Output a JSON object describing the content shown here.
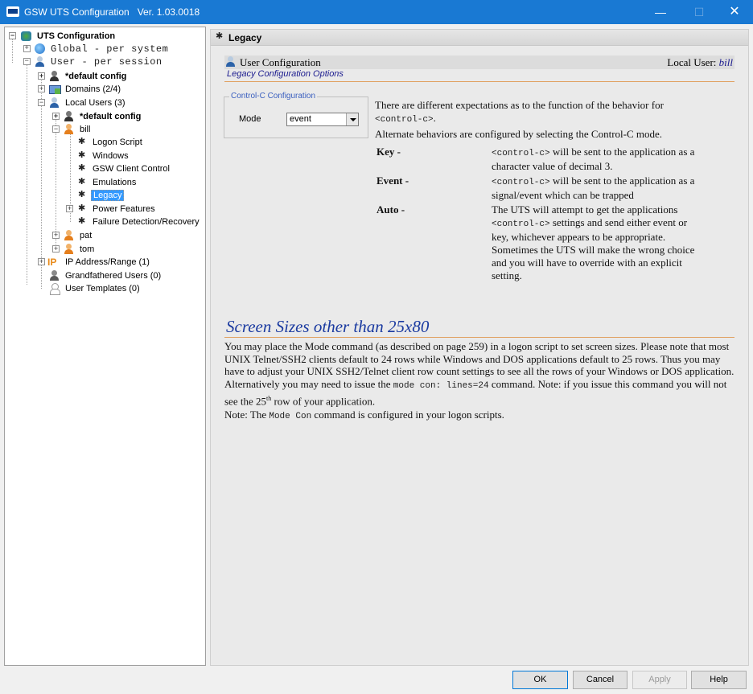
{
  "window": {
    "title": "GSW UTS Configuration",
    "version": "Ver. 1.03.0018",
    "min_glyph": "—",
    "max_glyph": "☐",
    "close_glyph": "✕"
  },
  "tree": {
    "root": "UTS Configuration",
    "global": "Global - per system",
    "user": "User  - per session",
    "default_config": "*default config",
    "domains": "Domains (2/4)",
    "local_users": "Local Users (3)",
    "local_default": "*default config",
    "bill": "bill",
    "bill_children": [
      "Logon Script",
      "Windows",
      "GSW Client Control",
      "Emulations",
      "Legacy",
      "Power Features",
      "Failure Detection/Recovery"
    ],
    "pat": "pat",
    "tom": "tom",
    "ip_range": "IP Address/Range (1)",
    "grandfathered": "Grandfathered Users (0)",
    "templates": "User Templates (0)"
  },
  "panel": {
    "title": "Legacy",
    "section_title": "User Configuration",
    "local_user_label": "Local User:",
    "local_user_name": "bill",
    "subtitle": "Legacy Configuration Options",
    "group_label": "Control-C Configuration",
    "mode_label": "Mode",
    "mode_value": "event",
    "intro_1": "There are different expectations as to the function of the behavior for",
    "intro_code": "<control-c>",
    "intro_dot": ".",
    "intro_2": "Alternate behaviors are configured by selecting the Control-C mode.",
    "key_term": "Key -",
    "key_code": "<control-c>",
    "key_def_a": " will be sent to the application as a",
    "key_def_b": "character value of decimal 3.",
    "event_term": "Event -",
    "event_code": "<control-c>",
    "event_def_a": " will be sent to the application as a",
    "event_def_b": "signal/event which can be trapped",
    "auto_term": "Auto -",
    "auto_def_1": "The UTS will attempt to get the applications",
    "auto_code": "<control-c>",
    "auto_def_2": " settings and send either event or",
    "auto_def_3": "key, whichever appears to be appropriate.",
    "auto_def_4": "Sometimes the UTS will make the wrong choice",
    "auto_def_5": "and you will have to override with an explicit",
    "auto_def_6": "setting.",
    "screen_heading": "Screen Sizes other than 25x80",
    "screen_body_1": "You may place the Mode command (as described on page 259) in a logon script to set screen sizes. Please note that most UNIX Telnet/SSH2 clients default to 24 rows while Windows and DOS applications default to 25 rows. Thus you may have to adjust your UNIX SSH2/Telnet client row count settings to see all the rows of your Windows or DOS application. Alternatively you may need to issue the ",
    "screen_code": "mode con: lines=24",
    "screen_body_2": " command. Note: if you issue this command you will not see the 25",
    "screen_sup": "th",
    "screen_body_3": " row of your application.",
    "note_1": "Note: The ",
    "note_code": "Mode Con",
    "note_2": " command is configured in your logon scripts."
  },
  "buttons": {
    "ok": "OK",
    "cancel": "Cancel",
    "apply": "Apply",
    "help": "Help"
  }
}
